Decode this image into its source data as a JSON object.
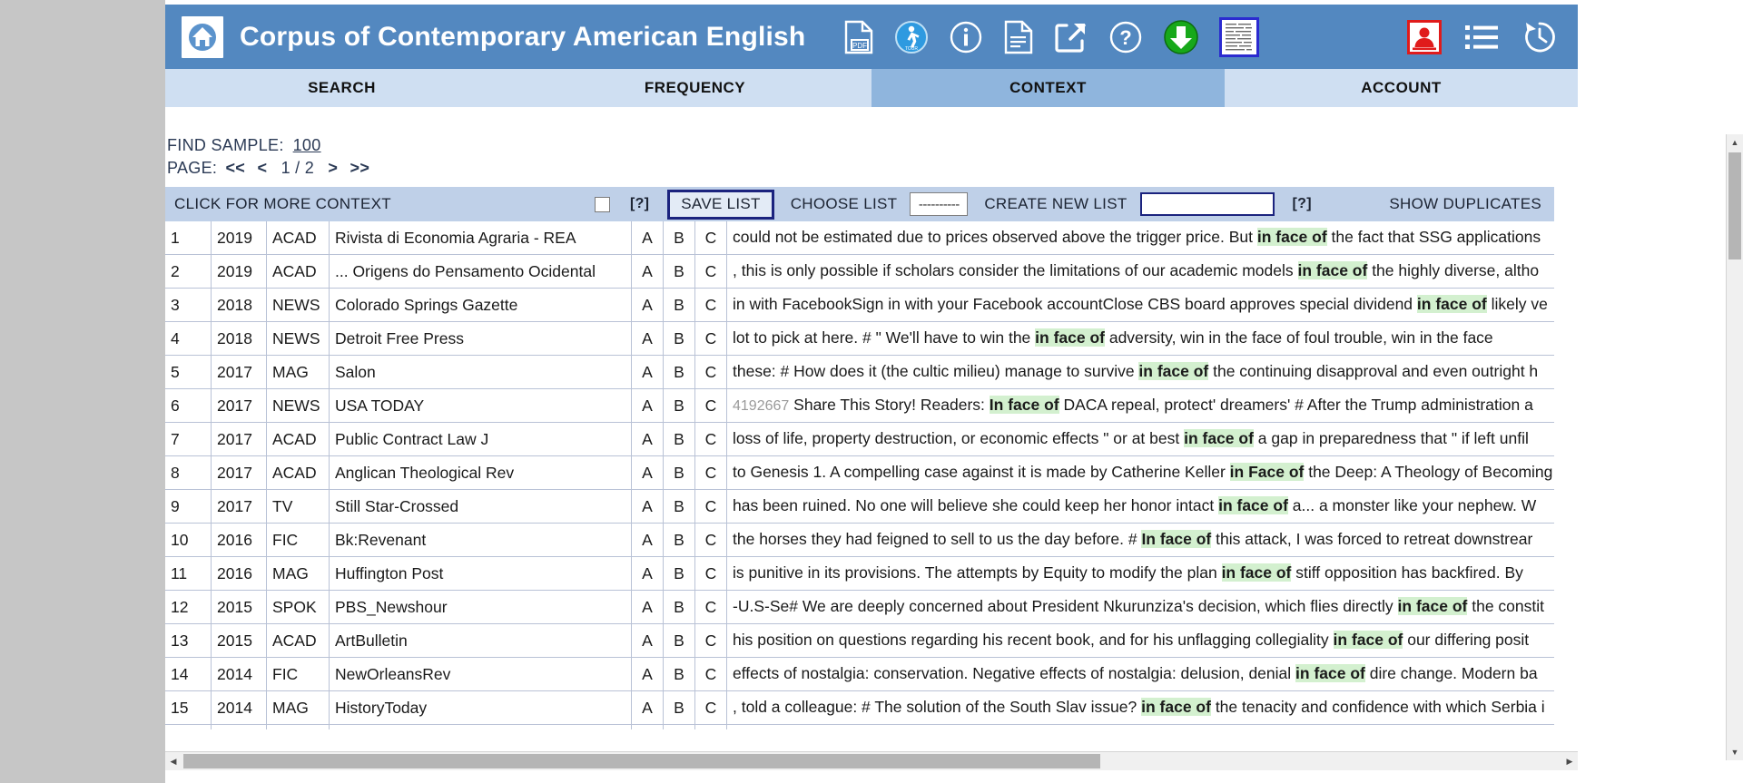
{
  "header": {
    "title": "Corpus of Contemporary American English",
    "home_icon": "home-icon",
    "icons": [
      {
        "name": "pdf-icon",
        "label": "PDF"
      },
      {
        "name": "tour-icon",
        "label": "TOUR"
      },
      {
        "name": "info-icon",
        "label": "i"
      },
      {
        "name": "document-icon",
        "label": ""
      },
      {
        "name": "share-external-icon",
        "label": ""
      },
      {
        "name": "help-icon",
        "label": "?"
      },
      {
        "name": "download-icon",
        "label": ""
      },
      {
        "name": "text-sample-icon",
        "label": ""
      }
    ],
    "right_icons": [
      {
        "name": "user-account-icon",
        "label": ""
      },
      {
        "name": "list-icon",
        "label": ""
      },
      {
        "name": "history-icon",
        "label": ""
      }
    ]
  },
  "tabs": [
    {
      "label": "SEARCH",
      "active": false
    },
    {
      "label": "FREQUENCY",
      "active": false
    },
    {
      "label": "CONTEXT",
      "active": true
    },
    {
      "label": "ACCOUNT",
      "active": false
    }
  ],
  "meta": {
    "find_sample_label": "FIND SAMPLE:",
    "find_sample_value": "100",
    "page_label": "PAGE:",
    "first_page": "<<",
    "prev_page": "<",
    "page_indicator": "1 / 2",
    "next_page": ">",
    "last_page": ">>"
  },
  "controls": {
    "click_for_more_context": "CLICK FOR MORE CONTEXT",
    "help_1": "[?]",
    "save_list": "SAVE LIST",
    "choose_list_label": "CHOOSE LIST",
    "choose_list_value": "----------",
    "create_new_list_label": "CREATE NEW LIST",
    "create_new_list_value": "",
    "help_2": "[?]",
    "show_duplicates": "SHOW DUPLICATES"
  },
  "table": {
    "col_a": "A",
    "col_b": "B",
    "col_c": "C",
    "rows": [
      {
        "num": "1",
        "year": "2019",
        "genre": "ACAD",
        "source": "Rivista di Economia Agraria - REA",
        "id": "",
        "pre": "could not be estimated due to prices observed above the trigger price. But ",
        "kw": "in face of",
        "post": " the fact that SSG applications"
      },
      {
        "num": "2",
        "year": "2019",
        "genre": "ACAD",
        "source": "... Origens do Pensamento Ocidental",
        "id": "",
        "pre": ", this is only possible if scholars consider the limitations of our academic models ",
        "kw": "in face of",
        "post": " the highly diverse, altho"
      },
      {
        "num": "3",
        "year": "2018",
        "genre": "NEWS",
        "source": "Colorado Springs Gazette",
        "id": "",
        "pre": "in with FacebookSign in with your Facebook accountClose CBS board approves special dividend ",
        "kw": "in face of",
        "post": " likely ve"
      },
      {
        "num": "4",
        "year": "2018",
        "genre": "NEWS",
        "source": "Detroit Free Press",
        "id": "",
        "pre": "lot to pick at here. # \" We'll have to win the ",
        "kw": "in face of",
        "post": " adversity, win in the face of foul trouble, win in the face"
      },
      {
        "num": "5",
        "year": "2017",
        "genre": "MAG",
        "source": "Salon",
        "id": "",
        "pre": "these: # How does it (the cultic milieu) manage to survive ",
        "kw": "in face of",
        "post": " the continuing disapproval and even outright h"
      },
      {
        "num": "6",
        "year": "2017",
        "genre": "NEWS",
        "source": "USA TODAY",
        "id": "4192667",
        "pre": "Share This Story! Readers: ",
        "kw": "In face of",
        "post": " DACA repeal, protect' dreamers' # After the Trump administration a"
      },
      {
        "num": "7",
        "year": "2017",
        "genre": "ACAD",
        "source": "Public Contract Law J",
        "id": "",
        "pre": "loss of life, property destruction, or economic effects \" or at best ",
        "kw": "in face of",
        "post": " a gap in preparedness that \" if left unfil"
      },
      {
        "num": "8",
        "year": "2017",
        "genre": "ACAD",
        "source": "Anglican Theological Rev",
        "id": "",
        "pre": "to Genesis 1. A compelling case against it is made by Catherine Keller ",
        "kw": "in Face of",
        "post": " the Deep: A Theology of Becoming"
      },
      {
        "num": "9",
        "year": "2017",
        "genre": "TV",
        "source": "Still Star-Crossed",
        "id": "",
        "pre": "has been ruined. No one will believe she could keep her honor intact ",
        "kw": "in face of",
        "post": " a... a monster like your nephew. W"
      },
      {
        "num": "10",
        "year": "2016",
        "genre": "FIC",
        "source": "Bk:Revenant",
        "id": "",
        "pre": "the horses they had feigned to sell to us the day before. # ",
        "kw": "In face of",
        "post": " this attack, I was forced to retreat downstrear"
      },
      {
        "num": "11",
        "year": "2016",
        "genre": "MAG",
        "source": "Huffington Post",
        "id": "",
        "pre": "is punitive in its provisions. The attempts by Equity to modify the plan ",
        "kw": "in face of",
        "post": " stiff opposition has backfired. By "
      },
      {
        "num": "12",
        "year": "2015",
        "genre": "SPOK",
        "source": "PBS_Newshour",
        "id": "",
        "pre": "-U.S-Se# We are deeply concerned about President Nkurunziza's decision, which flies directly ",
        "kw": "in face of",
        "post": " the constit"
      },
      {
        "num": "13",
        "year": "2015",
        "genre": "ACAD",
        "source": "ArtBulletin",
        "id": "",
        "pre": "his position on questions regarding his recent book, and for his unflagging collegiality ",
        "kw": "in face of",
        "post": " our differing posit"
      },
      {
        "num": "14",
        "year": "2014",
        "genre": "FIC",
        "source": "NewOrleansRev",
        "id": "",
        "pre": "effects of nostalgia: conservation. Negative effects of nostalgia: delusion, denial ",
        "kw": "in face of",
        "post": " dire change. Modern ba"
      },
      {
        "num": "15",
        "year": "2014",
        "genre": "MAG",
        "source": "HistoryToday",
        "id": "",
        "pre": ", told a colleague: # The solution of the South Slav issue? ",
        "kw": "in face of",
        "post": " the tenacity and confidence with which Serbia i"
      }
    ]
  },
  "colors": {
    "header_blue": "#5388c0",
    "tab_inactive": "#cfdff2",
    "tab_active": "#8fb5dd",
    "control_bar": "#bfd0e8",
    "highlight_green": "#d3f0cf",
    "page_background": "#c6c6c6"
  }
}
